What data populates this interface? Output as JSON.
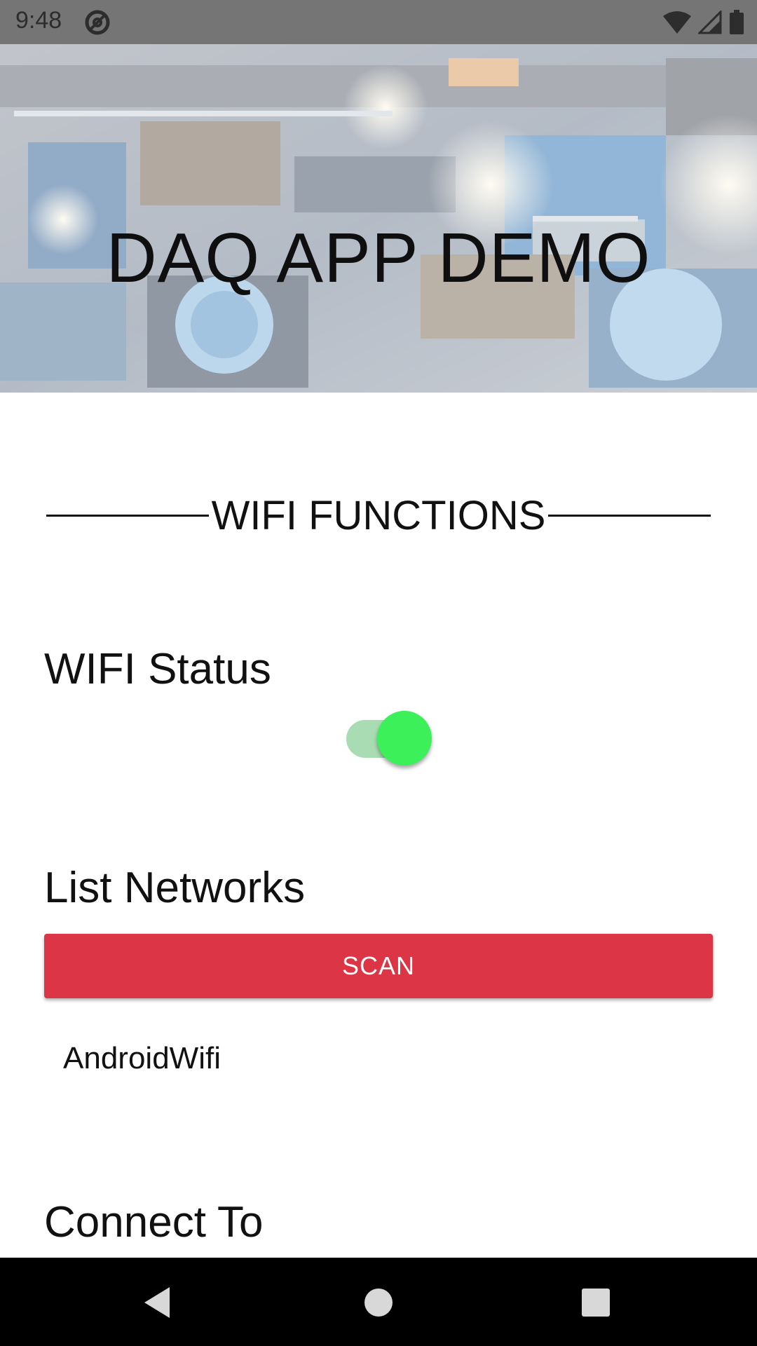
{
  "status_bar": {
    "time": "9:48",
    "icons": [
      "at-sign-icon",
      "wifi-icon",
      "cellular-signal-icon",
      "battery-icon"
    ]
  },
  "header": {
    "title": "DAQ APP DEMO"
  },
  "wifi_section": {
    "heading": "WIFI FUNCTIONS",
    "status_label": "WIFI Status",
    "status_toggle_on": true,
    "list_label": "List Networks",
    "scan_button_label": "SCAN",
    "networks": [
      "AndroidWifi"
    ],
    "connect_label": "Connect To"
  },
  "nav_bar": {
    "buttons": [
      "back-icon",
      "home-icon",
      "recents-icon"
    ]
  },
  "colors": {
    "accent_button": "#dc3545",
    "toggle_thumb": "#3cf05a",
    "toggle_track": "#a9dcb2"
  }
}
